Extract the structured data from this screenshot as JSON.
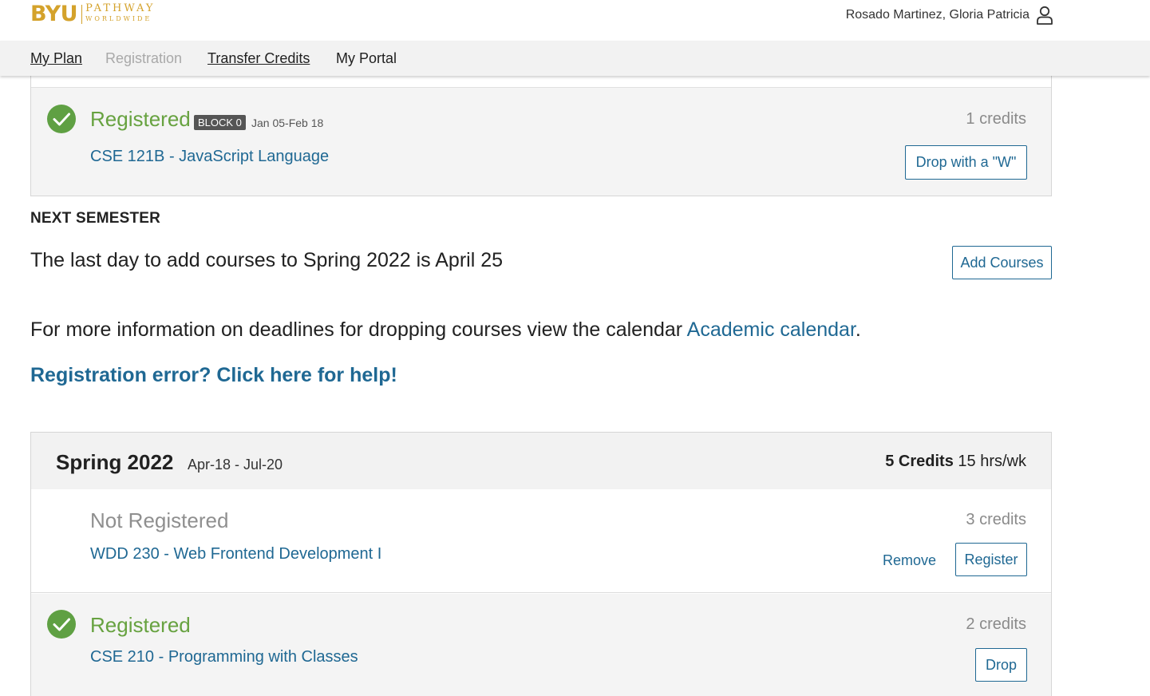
{
  "header": {
    "logo_main": "BYU",
    "logo_top": "PATHWAY",
    "logo_bottom": "WORLDWIDE",
    "user_name": "Rosado Martinez, Gloria Patricia"
  },
  "nav": {
    "items": [
      {
        "label": "My Plan"
      },
      {
        "label": "Registration"
      },
      {
        "label": "Transfer Credits"
      },
      {
        "label": "My Portal"
      }
    ]
  },
  "current": {
    "course": {
      "status": "Registered",
      "block": "BLOCK 0",
      "dates": "Jan 05-Feb 18",
      "name": "CSE 121B - JavaScript Language",
      "credits": "1 credits",
      "action": "Drop with a \"W\""
    }
  },
  "next_semester": {
    "heading": "NEXT SEMESTER",
    "last_day_text": "The last day to add courses to Spring 2022 is April 25",
    "add_courses_label": "Add Courses",
    "info_text": "For more information on deadlines for dropping courses view the calendar ",
    "calendar_link": "Academic calendar",
    "info_end": ".",
    "help_link": "Registration error? Click here for help!"
  },
  "semester": {
    "title": "Spring 2022",
    "dates": "Apr-18 - Jul-20",
    "credits": "5 Credits",
    "hours": "15 hrs/wk",
    "courses": [
      {
        "status": "Not Registered",
        "name": "WDD 230 - Web Frontend Development I",
        "credits": "3 credits",
        "remove_label": "Remove",
        "register_label": "Register"
      },
      {
        "status": "Registered",
        "name": "CSE 210 - Programming with Classes",
        "credits": "2 credits",
        "drop_label": "Drop"
      }
    ]
  },
  "colors": {
    "brand_gold": "#d4a22b",
    "link_blue": "#1f6893",
    "registered_green": "#67a240"
  }
}
